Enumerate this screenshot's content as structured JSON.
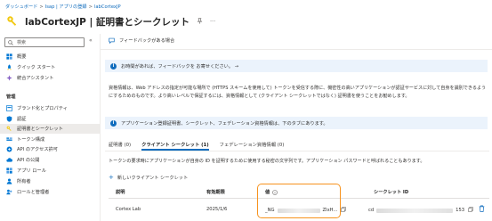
{
  "breadcrumb": {
    "items": [
      "ダッシュボード",
      "Isap | アプリの登録",
      "labCortexJP"
    ]
  },
  "header": {
    "title": "labCortexJP | 証明書とシークレット",
    "pin_icon": "pin-icon",
    "more_label": "···"
  },
  "sidebar": {
    "search_placeholder": "検索",
    "collapse_label": "«",
    "items_top": [
      {
        "label": "概要",
        "icon": "grid-icon"
      },
      {
        "label": "クイック スタート",
        "icon": "rocket-icon"
      },
      {
        "label": "統合アシスタント",
        "icon": "assistant-icon"
      }
    ],
    "section_label": "管理",
    "items_manage": [
      {
        "label": "ブランド化とプロパティ",
        "icon": "brand-icon"
      },
      {
        "label": "認証",
        "icon": "auth-icon"
      },
      {
        "label": "証明書とシークレット",
        "icon": "key-icon"
      },
      {
        "label": "トークン構成",
        "icon": "token-icon"
      },
      {
        "label": "API のアクセス許可",
        "icon": "api-permissions-icon"
      },
      {
        "label": "API の公開",
        "icon": "cloud-icon"
      },
      {
        "label": "アプリ ロール",
        "icon": "app-roles-icon"
      },
      {
        "label": "所有者",
        "icon": "owners-icon"
      },
      {
        "label": "ロールと管理者",
        "icon": "roles-admin-icon"
      }
    ]
  },
  "command_bar": {
    "feedback_label": "フィードバックがある場合"
  },
  "info_feedback": {
    "text": "お時間があれば、フィードバックを お寄せください。 →"
  },
  "description": "資格情報は、Web アドレスの指定が可能な場所で (HTTPS スキームを使用して) トークンを受信する際に、機密性の高いアプリケーションが認証サービスに対して自身を識別できるようにするためのものです。より高いレベルで保証するには、資格情報として (クライアント シークレットではなく) 証明書を使うことをお勧めします。",
  "info_credentials": {
    "text": "アプリケーション登録証明書、シークレット、フェデレーション資格情報は、下のタブにあります。"
  },
  "tabs": [
    {
      "label": "証明書 (0)"
    },
    {
      "label": "クライアント シークレット (1)"
    },
    {
      "label": "フェデレーション資格情報 (0)"
    }
  ],
  "tab_description": "トークンの要求時にアプリケーションが自身の ID を証明するために使用する秘密の文字列です。アプリケーション パスワードと呼ばれることもあります。",
  "new_secret_label": "新しいクライアント シークレット",
  "table": {
    "headers": [
      "説明",
      "有効期限",
      "値",
      "シークレット ID"
    ],
    "value_info_icon": "info-icon",
    "rows": [
      {
        "description": "Cortex Lab",
        "expires": "2025/1/6",
        "value_prefix": "_NG",
        "value_suffix": "ZIxH...",
        "secret_id_prefix": "cd",
        "secret_id_suffix": "153"
      }
    ]
  },
  "colors": {
    "accent": "#0f6cbd",
    "highlight": "#f7931e",
    "info_bg": "#ebf3fc"
  }
}
